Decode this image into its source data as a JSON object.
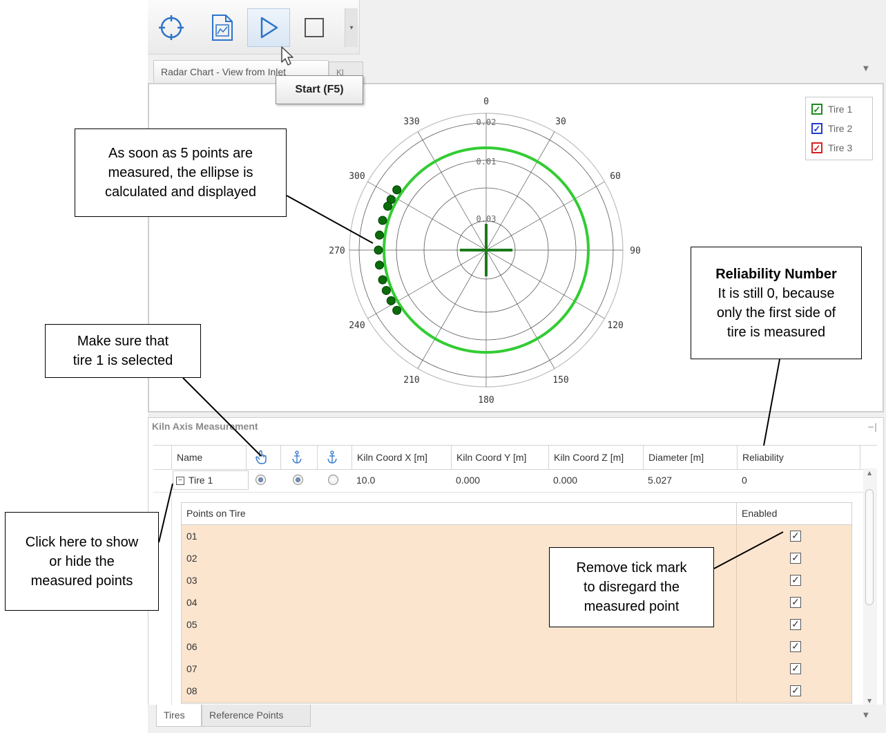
{
  "toolbar": {
    "buttons": [
      {
        "name": "crosshair-icon"
      },
      {
        "name": "chart-document-icon"
      },
      {
        "name": "play-icon"
      },
      {
        "name": "stop-icon"
      }
    ],
    "tooltip": "Start (F5)"
  },
  "doc_tabs": {
    "active_label": "Radar Chart - View from Inlet",
    "second_label": "Kl"
  },
  "radar_chart": {
    "angle_labels": [
      "0",
      "330",
      "300",
      "270",
      "240",
      "210",
      "180",
      "150",
      "120",
      "90",
      "60",
      "30"
    ],
    "radial_labels": [
      "0.02",
      "0.01",
      "0.03"
    ],
    "legend": [
      {
        "label": "Tire 1",
        "color": "#1a8a1a"
      },
      {
        "label": "Tire 2",
        "color": "#1f3bd1"
      },
      {
        "label": "Tire 3",
        "color": "#d62020"
      }
    ],
    "ellipse_color": "#33cc33",
    "point_color": "#0a6b0a"
  },
  "panel": {
    "title": "Kiln Axis Measurement",
    "columns": [
      "Name",
      "hand-pointer-icon",
      "anchor-icon",
      "anchor-icon",
      "Kiln Coord X [m]",
      "Kiln Coord Y [m]",
      "Kiln Coord Z [m]",
      "Diameter [m]",
      "Reliability"
    ],
    "row": {
      "name": "Tire 1",
      "expander": "−",
      "selected": true,
      "anchor1": true,
      "anchor2": false,
      "x": "10.0",
      "y": "0.000",
      "z": "0.000",
      "diameter": "5.027",
      "reliability": "0"
    },
    "detail": {
      "col_points": "Points on Tire",
      "col_enabled": "Enabled",
      "points": [
        {
          "label": "01",
          "enabled": true
        },
        {
          "label": "02",
          "enabled": true
        },
        {
          "label": "03",
          "enabled": true
        },
        {
          "label": "04",
          "enabled": true
        },
        {
          "label": "05",
          "enabled": true
        },
        {
          "label": "06",
          "enabled": true
        },
        {
          "label": "07",
          "enabled": true
        },
        {
          "label": "08",
          "enabled": true
        }
      ]
    },
    "bottom_tabs": [
      "Tires",
      "Reference Points"
    ]
  },
  "callouts": {
    "ellipse": [
      "As soon as 5 points are",
      "measured, the ellipse is",
      "calculated and displayed"
    ],
    "reliability_title": "Reliability Number",
    "reliability": [
      "It is still 0, because",
      "only the first side of",
      "tire is measured"
    ],
    "tire_selected": [
      "Make sure that",
      "tire 1 is selected"
    ],
    "show_hide": [
      "Click here to show",
      "or hide the",
      "measured points"
    ],
    "tick_mark": [
      "Remove tick mark",
      "to disregard the",
      "measured point"
    ]
  }
}
